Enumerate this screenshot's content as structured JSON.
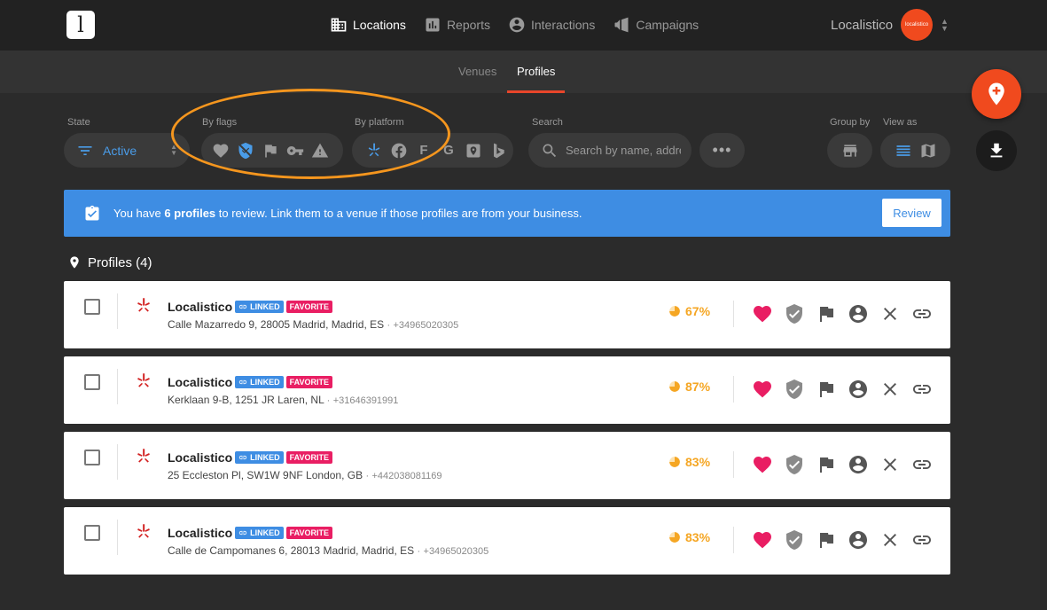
{
  "app": {
    "logo_letter": "l"
  },
  "nav": {
    "items": [
      {
        "label": "Locations",
        "icon": "building-icon",
        "active": true
      },
      {
        "label": "Reports",
        "icon": "bar-chart-icon",
        "active": false
      },
      {
        "label": "Interactions",
        "icon": "user-circle-icon",
        "active": false
      },
      {
        "label": "Campaigns",
        "icon": "megaphone-icon",
        "active": false
      }
    ]
  },
  "account": {
    "name": "Localistico",
    "avatar_text": "localistico",
    "avatar_color": "#f04a1e"
  },
  "subnav": {
    "tabs": [
      {
        "label": "Venues",
        "active": false
      },
      {
        "label": "Profiles",
        "active": true
      }
    ]
  },
  "filters": {
    "state_label": "State",
    "state_value": "Active",
    "flags_label": "By flags",
    "platform_label": "By platform",
    "platform_foursquare_glyph": "F",
    "platform_google_glyph": "G",
    "search_label": "Search",
    "search_placeholder": "Search by name, address...",
    "more_glyph": "•••",
    "group_by_label": "Group by",
    "view_as_label": "View as"
  },
  "banner": {
    "text_before": "You have ",
    "text_bold": "6 profiles",
    "text_after": " to review. Link them to a venue if those profiles are from your business.",
    "button": "Review",
    "color": "#3e8de3"
  },
  "list": {
    "header": "Profiles (4)"
  },
  "badges": {
    "linked": "LINKED",
    "favorite": "FAVORITE"
  },
  "profiles": [
    {
      "name": "Localistico",
      "address": "Calle Mazarredo 9, 28005 Madrid, Madrid, ES",
      "phone": "+34965020305",
      "score": "67%"
    },
    {
      "name": "Localistico",
      "address": "Kerklaan 9-B, 1251 JR Laren, NL",
      "phone": "+31646391991",
      "score": "87%"
    },
    {
      "name": "Localistico",
      "address": "25 Eccleston Pl, SW1W 9NF London, GB",
      "phone": "+442038081169",
      "score": "83%"
    },
    {
      "name": "Localistico",
      "address": "Calle de Campomanes 6, 28013 Madrid, Madrid, ES",
      "phone": "+34965020305",
      "score": "83%"
    }
  ],
  "colors": {
    "accent": "#f04a1e",
    "favorite": "#e91e63",
    "score": "#f5a623",
    "yelp": "#d32323",
    "annotation": "#f5961e"
  }
}
